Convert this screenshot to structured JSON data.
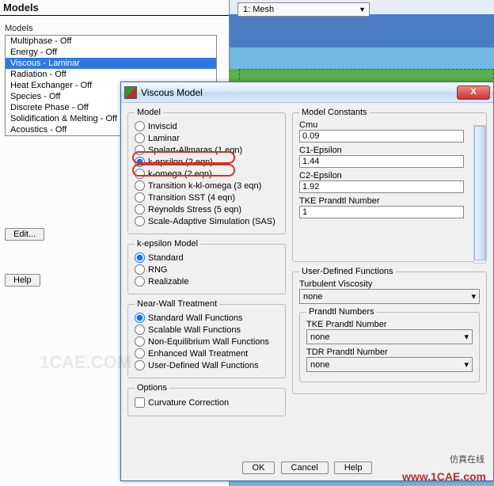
{
  "panel": {
    "title": "Models",
    "sub": "Models",
    "items": [
      "Multiphase - Off",
      "Energy - Off",
      "Viscous - Laminar",
      "Radiation - Off",
      "Heat Exchanger - Off",
      "Species - Off",
      "Discrete Phase - Off",
      "Solidification & Melting - Off",
      "Acoustics - Off"
    ],
    "active_index": 2,
    "edit_label": "Edit...",
    "help_label": "Help"
  },
  "top_dropdown": {
    "selected": "1: Mesh"
  },
  "dialog": {
    "title": "Viscous Model",
    "close": "X",
    "model_legend": "Model",
    "model_options": [
      "Inviscid",
      "Laminar",
      "Spalart-Allmaras (1 eqn)",
      "k-epsilon (2 eqn)",
      "k-omega (2 eqn)",
      "Transition k-kl-omega (3 eqn)",
      "Transition SST (4 eqn)",
      "Reynolds Stress (5 eqn)",
      "Scale-Adaptive Simulation (SAS)"
    ],
    "model_selected_index": 3,
    "ke_legend": "k-epsilon Model",
    "ke_options": [
      "Standard",
      "RNG",
      "Realizable"
    ],
    "ke_selected_index": 0,
    "nwt_legend": "Near-Wall Treatment",
    "nwt_options": [
      "Standard Wall Functions",
      "Scalable Wall Functions",
      "Non-Equilibrium Wall Functions",
      "Enhanced Wall Treatment",
      "User-Defined Wall Functions"
    ],
    "nwt_selected_index": 0,
    "opt_legend": "Options",
    "opt_curvature_label": "Curvature Correction",
    "opt_curvature_checked": false,
    "mc_legend": "Model Constants",
    "mc": {
      "cmu_label": "Cmu",
      "cmu": "0.09",
      "c1e_label": "C1-Epsilon",
      "c1e": "1.44",
      "c2e_label": "C2-Epsilon",
      "c2e": "1.92",
      "tkepr_label": "TKE Prandtl Number",
      "tkepr": "1"
    },
    "udf_legend": "User-Defined Functions",
    "udf": {
      "turb_visc_label": "Turbulent Viscosity",
      "turb_visc_value": "none",
      "pn_legend": "Prandtl Numbers",
      "tke_label": "TKE Prandtl Number",
      "tke_value": "none",
      "tdr_label": "TDR Prandtl Number",
      "tdr_value": "none"
    },
    "footer": {
      "ok": "OK",
      "cancel": "Cancel",
      "help": "Help"
    }
  },
  "watermarks": {
    "main": "1CAE.COM",
    "brand1": "仿真在线",
    "brand2": "www.1CAE.com"
  }
}
